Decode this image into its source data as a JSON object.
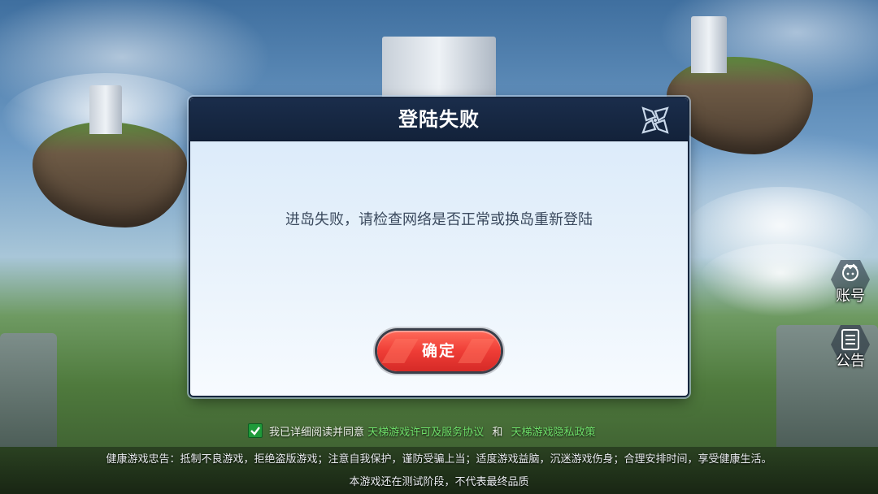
{
  "dialog": {
    "title": "登陆失败",
    "message": "进岛失败，请检查网络是否正常或换岛重新登陆",
    "confirm_label": "确定"
  },
  "side_buttons": {
    "account_label": "账号",
    "notice_label": "公告"
  },
  "agreement": {
    "prefix": "我已详细阅读并同意",
    "license_link": "天梯游戏许可及服务协议",
    "conjunction": "和",
    "privacy_link": "天梯游戏隐私政策",
    "checked": true
  },
  "footer": {
    "health_notice": "健康游戏忠告：抵制不良游戏，拒绝盗版游戏；注意自我保护，谨防受骗上当；适度游戏益脑，沉迷游戏伤身；合理安排时间，享受健康生活。",
    "test_notice": "本游戏还在测试阶段，不代表最终品质"
  },
  "icons": {
    "close": "close-x-icon",
    "account": "account-avatar-icon",
    "notice": "notice-board-icon",
    "checkbox": "checkmark-icon"
  },
  "colors": {
    "header_bg": "#13223a",
    "confirm_button": "#ef3d36",
    "link_green": "#6fe06a",
    "checkbox_green": "#1f9a3a"
  }
}
